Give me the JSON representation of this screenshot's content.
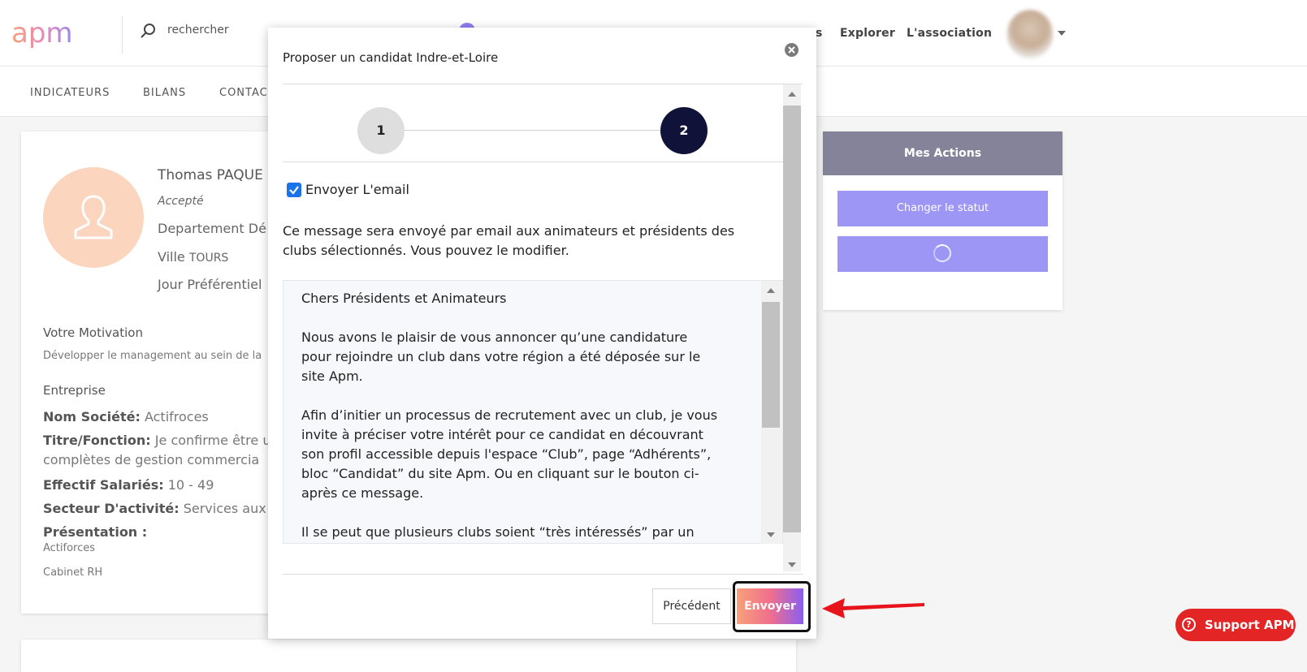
{
  "header": {
    "logo_text": "apm",
    "search_placeholder": "rechercher",
    "nav": [
      {
        "label": "s"
      },
      {
        "label": "Explorer"
      },
      {
        "label": "L'association"
      }
    ]
  },
  "subnav": {
    "items": [
      {
        "label": "INDICATEURS"
      },
      {
        "label": "BILANS"
      },
      {
        "label": "CONTAC"
      }
    ]
  },
  "profile": {
    "name": "Thomas PAQUE",
    "status": "Accepté",
    "department": "Departement Dé",
    "city_label": "Ville",
    "city_value": "TOURS",
    "day": "Jour Préférentiel",
    "motivation_title": "Votre Motivation",
    "motivation_text": "Développer le management au sein de la",
    "company_title": "Entreprise",
    "fields": [
      {
        "label": "Nom Société:",
        "value": "Actifroces"
      },
      {
        "label": "Titre/Fonction:",
        "value": "Je confirme être u"
      },
      {
        "label": "",
        "value": "complètes de gestion commercia"
      },
      {
        "label": "Effectif Salariés:",
        "value": "10 - 49"
      },
      {
        "label": "Secteur D'activité:",
        "value": "Services aux e"
      }
    ],
    "presentation_label": "Présentation :",
    "presentation_lines": [
      "Actiforces",
      "Cabinet RH"
    ]
  },
  "actions": {
    "title": "Mes Actions",
    "change_status": "Changer le statut"
  },
  "modal": {
    "title": "Proposer un candidat Indre-et-Loire",
    "steps": [
      "1",
      "2"
    ],
    "send_email_label": "Envoyer L'email",
    "info_lines": [
      "Ce message sera envoyé par email aux animateurs et présidents des",
      "clubs sélectionnés. Vous pouvez le modifier."
    ],
    "message_lines": [
      "Chers Présidents et Animateurs",
      "",
      "Nous avons le plaisir de vous annoncer qu’une candidature",
      "pour rejoindre un club dans votre région a été déposée sur le",
      "site Apm.",
      "",
      "Afin d’initier un processus de recrutement avec un club, je vous",
      "invite à préciser votre intérêt pour ce candidat en découvrant",
      "son profil accessible depuis l'espace “Club”, page “Adhérents”,",
      "bloc “Candidat” du site Apm. Ou en cliquant sur le bouton ci-",
      "après ce message.",
      "",
      "Il se peut que plusieurs clubs soient “très intéressés” par un"
    ],
    "prev_label": "Précédent",
    "send_label": "Envoyer"
  },
  "support": {
    "label": "Support APM",
    "icon": "?"
  },
  "colors": {
    "accent": "#9d96f4",
    "step_active": "#10123a",
    "support_red": "#e32525",
    "annotation_red": "#e8141c"
  }
}
